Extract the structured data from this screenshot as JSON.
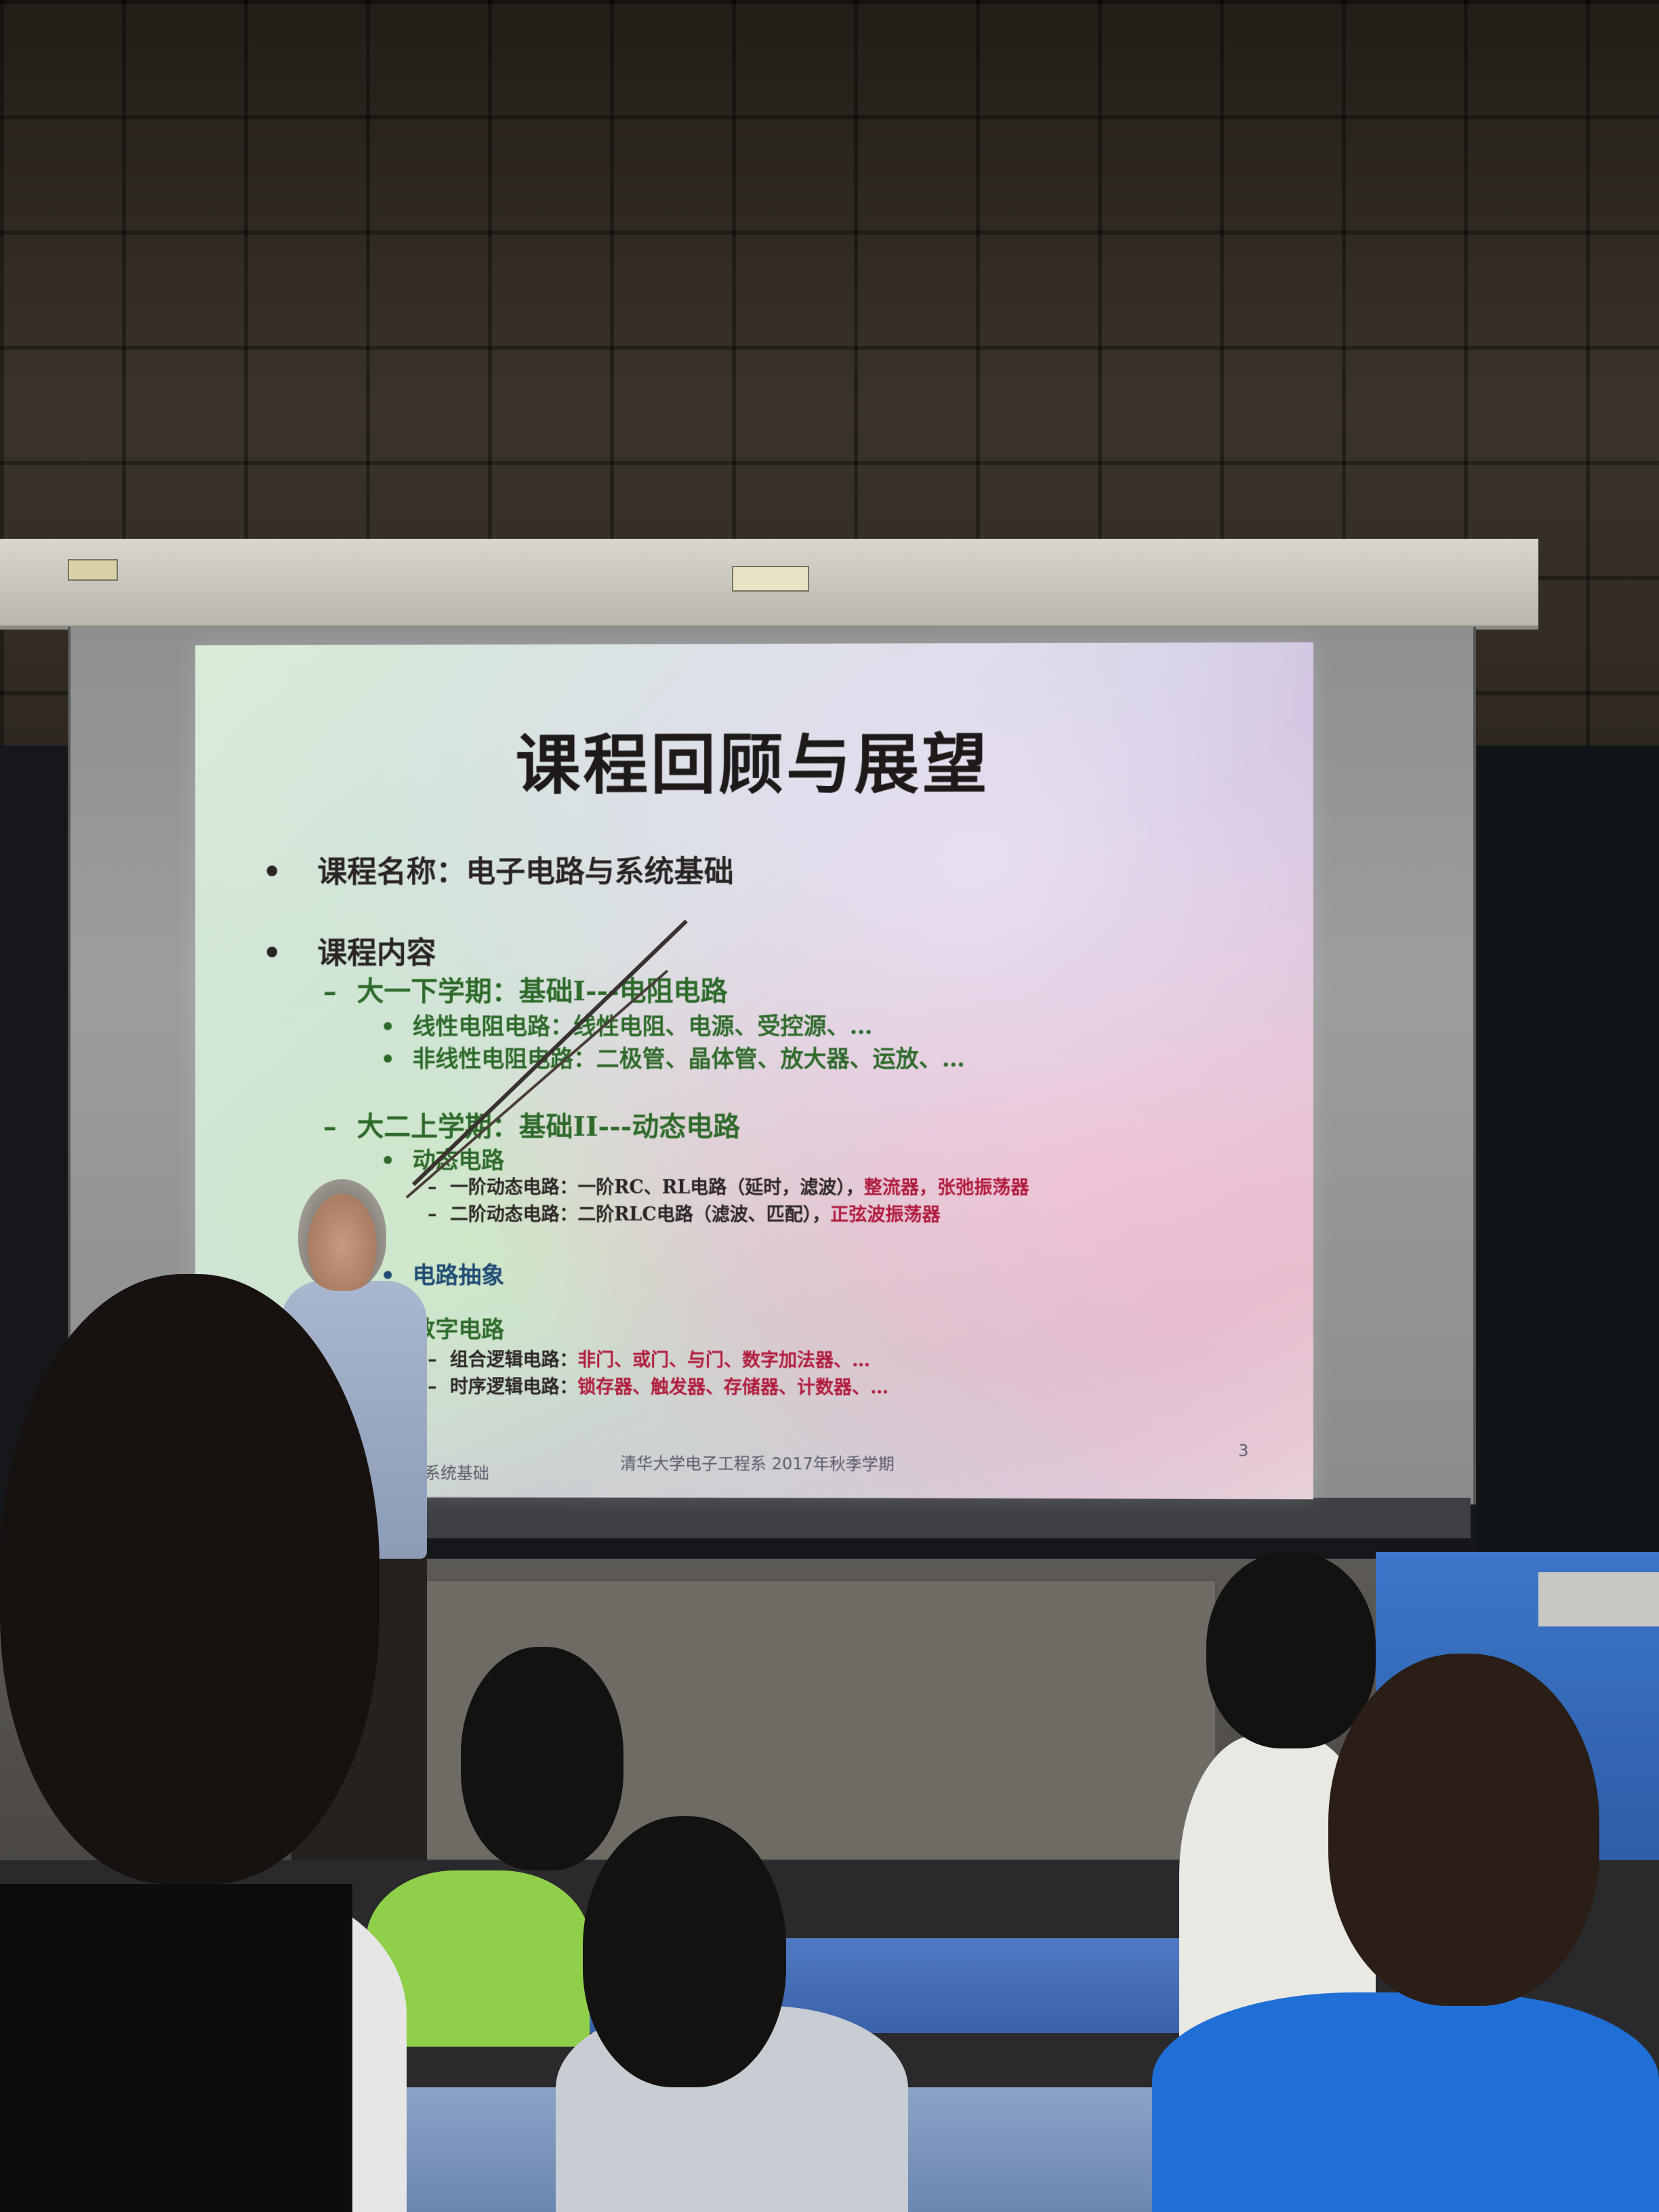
{
  "slide": {
    "title": "课程回顾与展望",
    "items": [
      {
        "bullet": "•",
        "text": "课程名称：电子电路与系统基础"
      },
      {
        "bullet": "•",
        "text": "课程内容"
      }
    ],
    "term1": {
      "dash": "–",
      "text": "大一下学期：基础I---电阻电路",
      "sub": [
        {
          "bullet": "•",
          "text": "线性电阻电路：线性电阻、电源、受控源、…"
        },
        {
          "bullet": "•",
          "text": "非线性电阻电路：二极管、晶体管、放大器、运放、…"
        }
      ]
    },
    "term2": {
      "dash": "–",
      "text": "大二上学期：基础II---动态电路",
      "dynamic": {
        "bullet": "•",
        "text": "动态电路",
        "rows": [
          {
            "dash": "–",
            "prefix": "一阶动态电路：一阶RC、RL电路（延时，滤波），",
            "highlight": "整流器，张弛振荡器"
          },
          {
            "dash": "–",
            "prefix": "二阶动态电路：二阶RLC电路（滤波、匹配），",
            "highlight": "正弦波振荡器"
          }
        ]
      },
      "abstraction": {
        "bullet": "•",
        "text": "电路抽象"
      },
      "digital": {
        "bullet": "•",
        "text": "数字电路",
        "rows": [
          {
            "dash": "–",
            "prefix": "组合逻辑电路：",
            "highlight": "非门、或门、与门、数字加法器、…"
          },
          {
            "dash": "–",
            "prefix": "时序逻辑电路：",
            "highlight": "锁存器、触发器、存储器、计数器、…"
          }
        ]
      }
    },
    "footer": {
      "left": "系统基础",
      "center": "清华大学电子工程系 2017年秋季学期",
      "page": "3"
    }
  },
  "colors": {
    "title": "#1f1a1a",
    "level2": "#2d6a2a",
    "abstraction": "#1e4a73",
    "highlight": "#b11a3c",
    "podium": "#3c76c9"
  }
}
